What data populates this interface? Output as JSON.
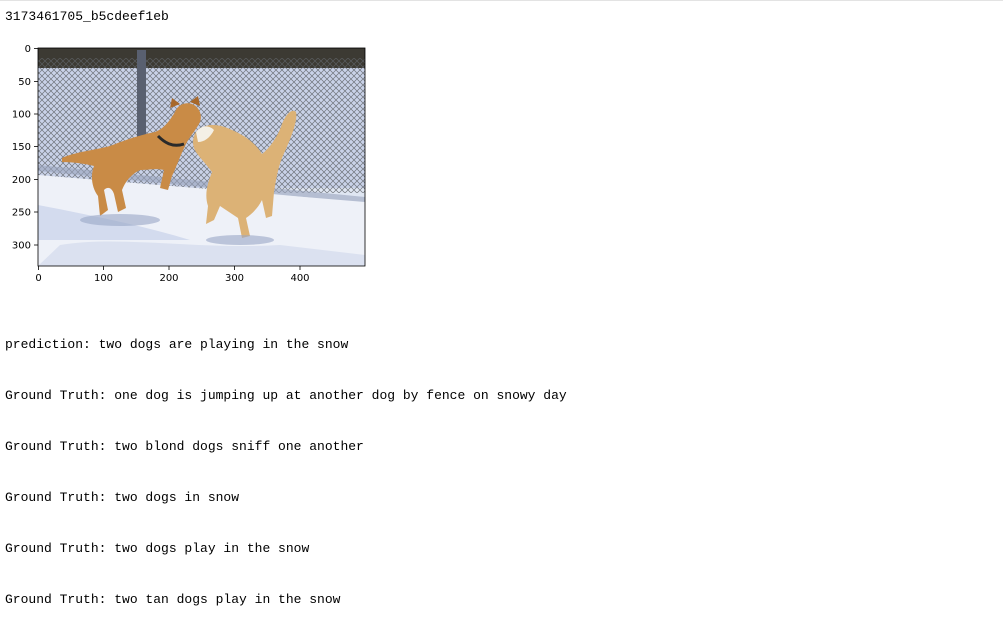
{
  "output": {
    "image_id": "3173461705_b5cdeef1eb",
    "plot": {
      "x_ticks": [
        "0",
        "100",
        "200",
        "300",
        "400"
      ],
      "y_ticks": [
        "0",
        "50",
        "100",
        "150",
        "200",
        "250",
        "300"
      ],
      "image_subject": "two dogs playing in snow by chain-link fence"
    },
    "prediction": "prediction: two dogs are playing in the snow",
    "ground_truths": [
      "Ground Truth: one dog is jumping up at another dog by fence on snowy day",
      "Ground Truth: two blond dogs sniff one another",
      "Ground Truth: two dogs in snow",
      "Ground Truth: two dogs play in the snow",
      "Ground Truth: two tan dogs play in the snow"
    ]
  }
}
